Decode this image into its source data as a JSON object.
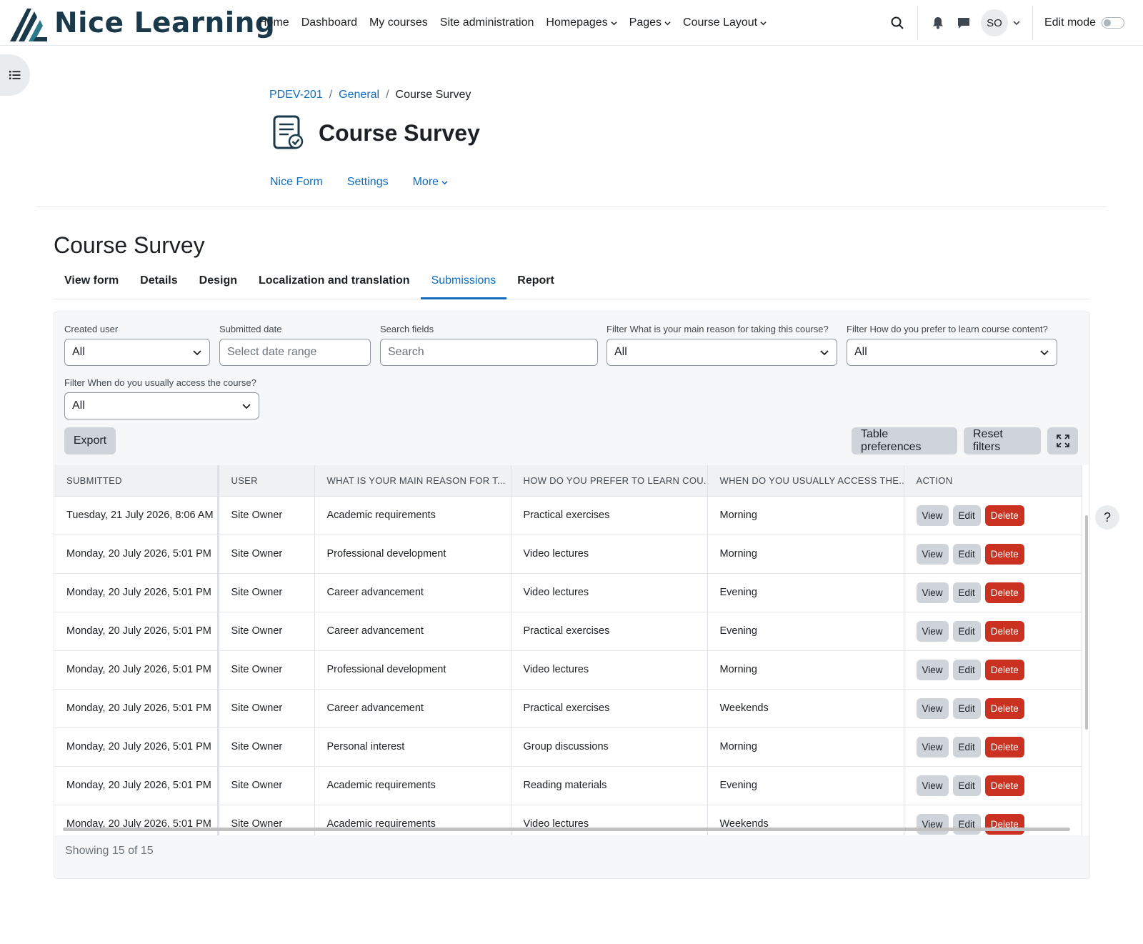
{
  "brand": {
    "name": "Nice Learning"
  },
  "nav": {
    "links": [
      {
        "label": "Home",
        "dropdown": false
      },
      {
        "label": "Dashboard",
        "dropdown": false
      },
      {
        "label": "My courses",
        "dropdown": false
      },
      {
        "label": "Site administration",
        "dropdown": false
      },
      {
        "label": "Homepages",
        "dropdown": true
      },
      {
        "label": "Pages",
        "dropdown": true
      },
      {
        "label": "Course Layout",
        "dropdown": true
      }
    ],
    "user_initials": "SO",
    "edit_mode_label": "Edit mode"
  },
  "breadcrumb": {
    "course": "PDEV-201",
    "section": "General",
    "current": "Course Survey"
  },
  "page": {
    "title": "Course Survey"
  },
  "secondary_nav": {
    "items": [
      "Nice Form",
      "Settings",
      "More"
    ]
  },
  "main": {
    "title": "Course Survey",
    "tabs": [
      "View form",
      "Details",
      "Design",
      "Localization and translation",
      "Submissions",
      "Report"
    ],
    "active_tab": "Submissions"
  },
  "filters": {
    "created_user": {
      "label": "Created user",
      "value": "All"
    },
    "submitted_date": {
      "label": "Submitted date",
      "placeholder": "Select date range"
    },
    "search_fields": {
      "label": "Search fields",
      "placeholder": "Search"
    },
    "reason": {
      "label": "Filter What is your main reason for taking this course?",
      "value": "All"
    },
    "learn": {
      "label": "Filter How do you prefer to learn course content?",
      "value": "All"
    },
    "access": {
      "label": "Filter When do you usually access the course?",
      "value": "All"
    }
  },
  "buttons": {
    "export": "Export",
    "table_preferences": "Table preferences",
    "reset_filters": "Reset filters"
  },
  "table": {
    "columns": [
      "SUBMITTED",
      "USER",
      "WHAT IS YOUR MAIN REASON FOR T...",
      "HOW DO YOU PREFER TO LEARN COU...",
      "WHEN DO YOU USUALLY ACCESS THE...",
      "ACTION"
    ],
    "action_labels": {
      "view": "View",
      "edit": "Edit",
      "delete": "Delete"
    },
    "rows": [
      [
        "Tuesday, 21 July 2026, 8:06 AM",
        "Site Owner",
        "Academic requirements",
        "Practical exercises",
        "Morning"
      ],
      [
        "Monday, 20 July 2026, 5:01 PM",
        "Site Owner",
        "Professional development",
        "Video lectures",
        "Morning"
      ],
      [
        "Monday, 20 July 2026, 5:01 PM",
        "Site Owner",
        "Career advancement",
        "Video lectures",
        "Evening"
      ],
      [
        "Monday, 20 July 2026, 5:01 PM",
        "Site Owner",
        "Career advancement",
        "Practical exercises",
        "Evening"
      ],
      [
        "Monday, 20 July 2026, 5:01 PM",
        "Site Owner",
        "Professional development",
        "Video lectures",
        "Morning"
      ],
      [
        "Monday, 20 July 2026, 5:01 PM",
        "Site Owner",
        "Career advancement",
        "Practical exercises",
        "Weekends"
      ],
      [
        "Monday, 20 July 2026, 5:01 PM",
        "Site Owner",
        "Personal interest",
        "Group discussions",
        "Morning"
      ],
      [
        "Monday, 20 July 2026, 5:01 PM",
        "Site Owner",
        "Academic requirements",
        "Reading materials",
        "Evening"
      ],
      [
        "Monday, 20 July 2026, 5:01 PM",
        "Site Owner",
        "Academic requirements",
        "Video lectures",
        "Weekends"
      ]
    ],
    "footer": "Showing 15 of 15"
  },
  "help": {
    "label": "?"
  },
  "colors": {
    "link": "#0f6cbf",
    "danger": "#ca3120",
    "brand": "#1a3a4c"
  }
}
